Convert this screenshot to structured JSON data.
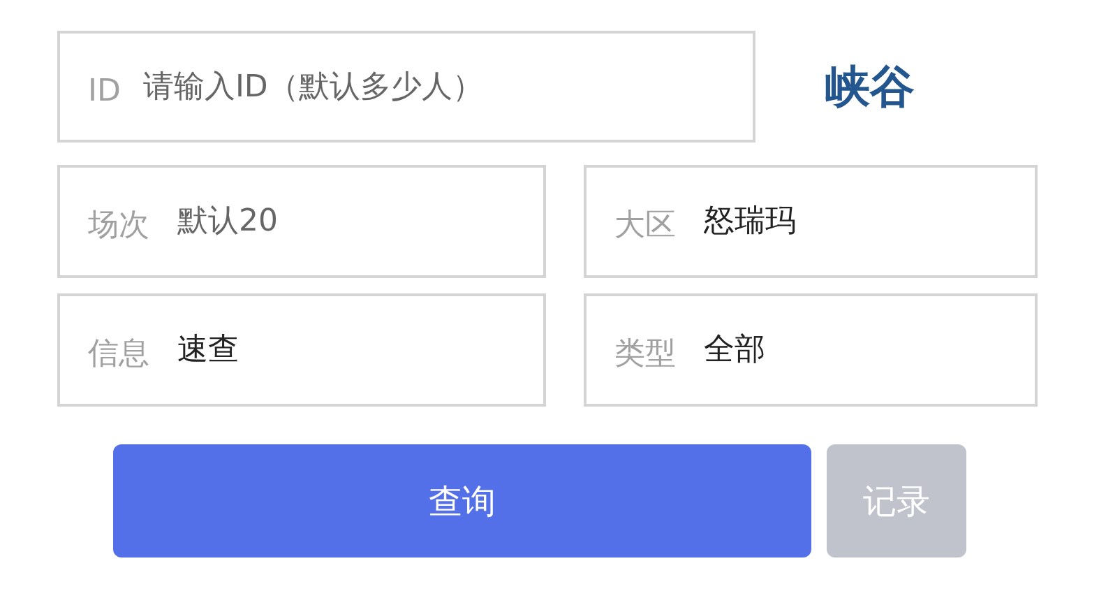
{
  "id_field": {
    "label": "ID",
    "placeholder": "请输入ID（默认多少人）"
  },
  "region_title": "峡谷",
  "fields": [
    {
      "label": "场次",
      "placeholder": "默认20"
    },
    {
      "label": "大区",
      "value": "怒瑞玛"
    },
    {
      "label": "信息",
      "value": "速查"
    },
    {
      "label": "类型",
      "value": "全部"
    }
  ],
  "buttons": [
    {
      "label": "查询",
      "kind": "primary"
    },
    {
      "label": "记录",
      "kind": "secondary"
    }
  ]
}
